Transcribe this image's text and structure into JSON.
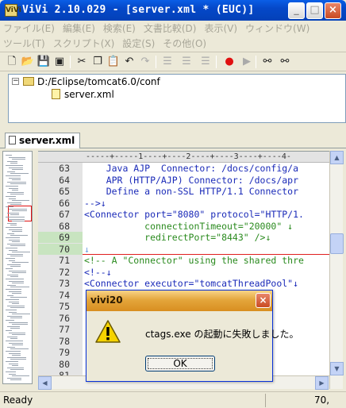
{
  "window": {
    "app_icon": "ViVi",
    "title": "ViVi 2.10.029 - [server.xml * (EUC)]"
  },
  "menu": {
    "row1": [
      "ファイル(E)",
      "編集(E)",
      "検索(E)",
      "文書比較(D)",
      "表示(V)",
      "ウィンドウ(W)"
    ],
    "row2": [
      "ツール(T)",
      "スクリプト(X)",
      "設定(S)",
      "その他(O)"
    ]
  },
  "toolbar": {
    "icons": [
      "new-file-icon",
      "open-folder-icon",
      "save-icon",
      "save-all-icon",
      "cut-icon",
      "copy-icon",
      "paste-icon",
      "undo-icon",
      "redo-icon",
      "align-left-icon",
      "align-center-icon",
      "align-right-icon",
      "record-icon",
      "play-icon",
      "find-icon",
      "find-next-icon"
    ],
    "record_color": "#e01010"
  },
  "tree": {
    "root": "D:/Eclipse/tomcat6.0/conf",
    "child": "server.xml",
    "expander": "−"
  },
  "tab": {
    "label": "server.xml"
  },
  "ruler": "-----+-----1----+----2----+----3----+----4-",
  "editor": {
    "lines": [
      {
        "n": "63",
        "code": "    Java AJP  Connector: /docs/config/a",
        "color": "blue",
        "diff": false
      },
      {
        "n": "64",
        "code": "    APR (HTTP/AJP) Connector: /docs/apr",
        "color": "blue",
        "diff": false
      },
      {
        "n": "65",
        "code": "    Define a non-SSL HTTP/1.1 Connector",
        "color": "blue",
        "diff": false
      },
      {
        "n": "66",
        "code": "-->↓",
        "color": "blue",
        "diff": false
      },
      {
        "n": "67",
        "code": "<Connector port=\"8080\" protocol=\"HTTP/1.",
        "color": "blue",
        "diff": false
      },
      {
        "n": "68",
        "code": "           connectionTimeout=\"20000\" ↓",
        "color": "green",
        "diff": false
      },
      {
        "n": "69",
        "code": "           redirectPort=\"8443\" />↓",
        "color": "green",
        "diff": true
      },
      {
        "n": "70",
        "code": "↓",
        "color": "sym",
        "diff": true
      },
      {
        "n": "71",
        "code": "<!-- A \"Connector\" using the shared thre",
        "color": "green",
        "diff": false
      },
      {
        "n": "72",
        "code": "<!--↓",
        "color": "blue",
        "diff": false
      },
      {
        "n": "73",
        "code": "<Connector executor=\"tomcatThreadPool\"↓",
        "color": "blue",
        "diff": false
      },
      {
        "n": "74",
        "code": "                   \"HTTP/1.",
        "color": "blue",
        "diff": false
      },
      {
        "n": "75",
        "code": "                   \"20000\" ↓",
        "color": "blue",
        "diff": false
      },
      {
        "n": "76",
        "code": "                   />↓",
        "color": "blue",
        "diff": false
      },
      {
        "n": "77",
        "code": "",
        "color": "blue",
        "diff": false
      },
      {
        "n": "78",
        "code": "                   nector on",
        "color": "green",
        "diff": false
      },
      {
        "n": "79",
        "code": "                   SSE config",
        "color": "green",
        "diff": false
      },
      {
        "n": "80",
        "code": "                   the OpenS",
        "color": "green",
        "diff": false
      },
      {
        "n": "81",
        "code": "                   mentation",
        "color": "green",
        "diff": false
      }
    ]
  },
  "status": {
    "text": "Ready",
    "position": "70,"
  },
  "dialog": {
    "title": "vivi20",
    "message": "ctags.exe の起動に失敗しました。",
    "ok_label": "OK",
    "icon": "warning-icon"
  }
}
